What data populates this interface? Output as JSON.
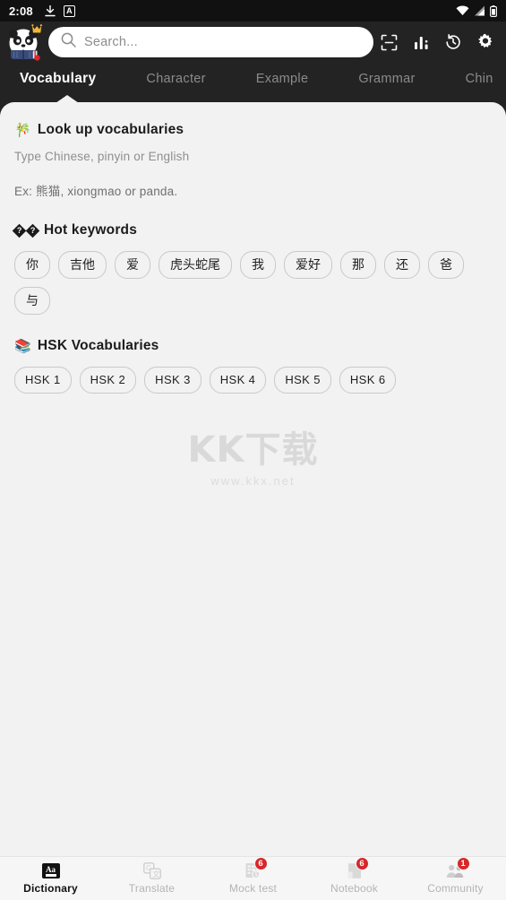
{
  "status_bar": {
    "time": "2:08",
    "left_icons": [
      "download-icon",
      "a-badge-icon"
    ],
    "right_icons": [
      "wifi-icon",
      "signal-icon",
      "battery-icon"
    ]
  },
  "header": {
    "logo": "panda-crown-logo",
    "search": {
      "placeholder": "Search...",
      "value": "",
      "icon": "search-icon"
    },
    "actions": [
      {
        "name": "scan-icon",
        "label": "Scan"
      },
      {
        "name": "chart-icon",
        "label": "Statistics"
      },
      {
        "name": "history-icon",
        "label": "History"
      },
      {
        "name": "settings-icon",
        "label": "Settings"
      }
    ]
  },
  "tabs": [
    {
      "label": "Vocabulary",
      "active": true
    },
    {
      "label": "Character",
      "active": false
    },
    {
      "label": "Example",
      "active": false
    },
    {
      "label": "Grammar",
      "active": false
    },
    {
      "label": "Chin",
      "active": false
    }
  ],
  "lookup": {
    "emoji": "🎋",
    "title": "Look up vocabularies",
    "hint": "Type Chinese, pinyin or English",
    "example": "Ex: 熊猫, xiongmao or panda."
  },
  "hot_keywords": {
    "glyph": "?",
    "title": "Hot keywords",
    "items": [
      "你",
      "吉他",
      "爱",
      "虎头蛇尾",
      "我",
      "爱好",
      "那",
      "还",
      "爸",
      "与"
    ]
  },
  "hsk": {
    "emoji": "📚",
    "title": "HSK Vocabularies",
    "items": [
      "HSK 1",
      "HSK 2",
      "HSK 3",
      "HSK 4",
      "HSK 5",
      "HSK 6"
    ]
  },
  "watermark": {
    "main": "KK下载",
    "sub": "www.kkx.net"
  },
  "bottom_nav": [
    {
      "label": "Dictionary",
      "icon": "dictionary-aa-icon",
      "badge": "",
      "active": true
    },
    {
      "label": "Translate",
      "icon": "translate-icon",
      "badge": "",
      "active": false
    },
    {
      "label": "Mock test",
      "icon": "mock-test-icon",
      "badge": "6",
      "active": false
    },
    {
      "label": "Notebook",
      "icon": "notebook-icon",
      "badge": "6",
      "active": false
    },
    {
      "label": "Community",
      "icon": "community-icon",
      "badge": "1",
      "active": false
    }
  ],
  "colors": {
    "header_bg": "#232324",
    "status_bg": "#111112",
    "card_bg": "#f2f2f2",
    "badge_red": "#d7262a",
    "nav_bg": "#f6f6f6"
  }
}
